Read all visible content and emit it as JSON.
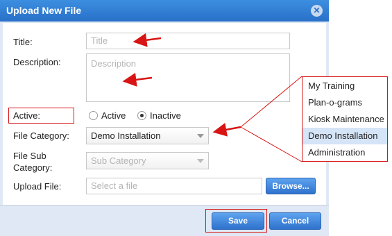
{
  "dialog": {
    "title": "Upload New File",
    "close_icon": "close-icon"
  },
  "form": {
    "title_label": "Title:",
    "title_placeholder": "Title",
    "description_label": "Description:",
    "description_placeholder": "Description",
    "active_label": "Active:",
    "active_options": [
      "Active",
      "Inactive"
    ],
    "active_selected": "Inactive",
    "file_category_label": "File Category:",
    "file_category_value": "Demo Installation",
    "file_sub_category_label_line1": "File Sub",
    "file_sub_category_label_line2": "Category:",
    "file_sub_category_placeholder": "Sub Category",
    "upload_file_label": "Upload File:",
    "upload_placeholder": "Select a file",
    "browse_label": "Browse..."
  },
  "footer": {
    "save_label": "Save",
    "cancel_label": "Cancel"
  },
  "category_dropdown": {
    "items": [
      "My Training",
      "Plan-o-grams",
      "Kiosk Maintenance",
      "Demo Installation",
      "Administration"
    ],
    "selected": "Demo Installation"
  },
  "colors": {
    "titlebar": "#2f7ad6",
    "annotation_red": "#d81414",
    "button_blue": "#3a7fd6",
    "dialog_bg": "#dfe8f4"
  }
}
